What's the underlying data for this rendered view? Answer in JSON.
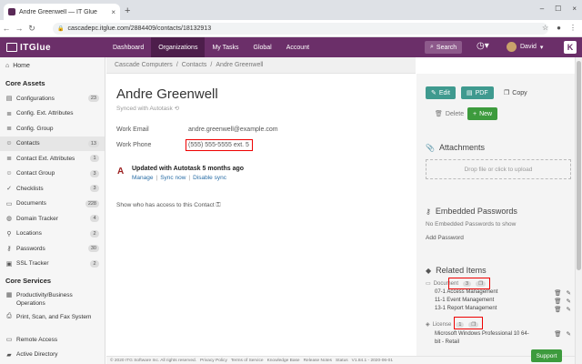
{
  "browser": {
    "tab_title": "Andre Greenwell — IT Glue",
    "tab_close": "×",
    "new_tab": "+",
    "url": "cascadepc.itglue.com/2884409/contacts/18132913",
    "window_controls": [
      "–",
      "☐",
      "×"
    ]
  },
  "header": {
    "logo_text": "ITGlue",
    "nav": [
      {
        "label": "Dashboard",
        "active": false
      },
      {
        "label": "Organizations",
        "active": true
      },
      {
        "label": "My Tasks",
        "active": false
      },
      {
        "label": "Global",
        "active": false
      },
      {
        "label": "Account",
        "active": false
      }
    ],
    "search_label": "Search",
    "user_name": "David",
    "kaseya_letter": "K"
  },
  "sidebar": {
    "home": "Home",
    "core_assets_title": "Core Assets",
    "items": [
      {
        "label": "Configurations",
        "count": "23",
        "icon": "server-icon"
      },
      {
        "label": "Config. Ext. Attributes",
        "count": "",
        "icon": "list-icon"
      },
      {
        "label": "Config. Group",
        "count": "",
        "icon": "list-icon"
      },
      {
        "label": "Contacts",
        "count": "13",
        "icon": "users-icon",
        "active": true
      },
      {
        "label": "Contact Ext. Attributes",
        "count": "1",
        "icon": "list-icon"
      },
      {
        "label": "Contact Group",
        "count": "3",
        "icon": "users-icon"
      },
      {
        "label": "Checklists",
        "count": "3",
        "icon": "check-icon"
      },
      {
        "label": "Documents",
        "count": "228",
        "icon": "document-icon"
      },
      {
        "label": "Domain Tracker",
        "count": "4",
        "icon": "globe-icon"
      },
      {
        "label": "Locations",
        "count": "2",
        "icon": "location-icon"
      },
      {
        "label": "Passwords",
        "count": "30",
        "icon": "key-icon"
      },
      {
        "label": "SSL Tracker",
        "count": "2",
        "icon": "lock-icon"
      }
    ],
    "core_services_title": "Core Services",
    "services": [
      {
        "label": "Productivity/Business Operations",
        "icon": "grid-icon"
      },
      {
        "label": "Print, Scan, and Fax System",
        "icon": "printer-icon"
      },
      {
        "label": "Remote Access",
        "icon": "desktop-icon"
      },
      {
        "label": "Active Directory",
        "icon": "folder-icon"
      }
    ]
  },
  "breadcrumb": [
    "Cascade Computers",
    "Contacts",
    "Andre Greenwell"
  ],
  "contact": {
    "name": "Andre Greenwell",
    "synced": "Synced with Autotask",
    "email_label": "Work Email",
    "email": "andre.greenwell@example.com",
    "phone_label": "Work Phone",
    "phone": "(555) 555-5555 ext. 5",
    "autotask_title": "Updated with Autotask 5 months ago",
    "autotask_links": [
      "Manage",
      "Sync now",
      "Disable sync"
    ],
    "show_access": "Show who has access to this Contact"
  },
  "actions": {
    "edit": "Edit",
    "pdf": "PDF",
    "copy": "Copy",
    "delete": "Delete",
    "new": "New"
  },
  "attachments": {
    "title": "Attachments",
    "dropzone": "Drop file or click to upload"
  },
  "embedded_passwords": {
    "title": "Embedded Passwords",
    "empty": "No Embedded Passwords to show",
    "add": "Add Password"
  },
  "related": {
    "title": "Related Items",
    "documents_label": "Document",
    "documents_count": "3",
    "documents": [
      "07-1 Access Management",
      "11-1 Event Management",
      "13-1 Report Management"
    ],
    "licenses_label": "License",
    "licenses_count": "1",
    "licenses": [
      "Microsoft Windows Professional 10 64-bit - Retail"
    ]
  },
  "footer": {
    "copyright": "© 2020 ITG Software Inc. All rights reserved.",
    "links": [
      "Privacy Policy",
      "Terms of Service",
      "Knowledge Base",
      "Release Notes",
      "Status"
    ],
    "version": "V1.84.1 - 2020-06-01"
  },
  "support_label": "Support",
  "colors": {
    "brand": "#6b2f69",
    "teal": "#3f9a8f",
    "green": "#3d9b3d",
    "highlight": "#ee0000"
  }
}
